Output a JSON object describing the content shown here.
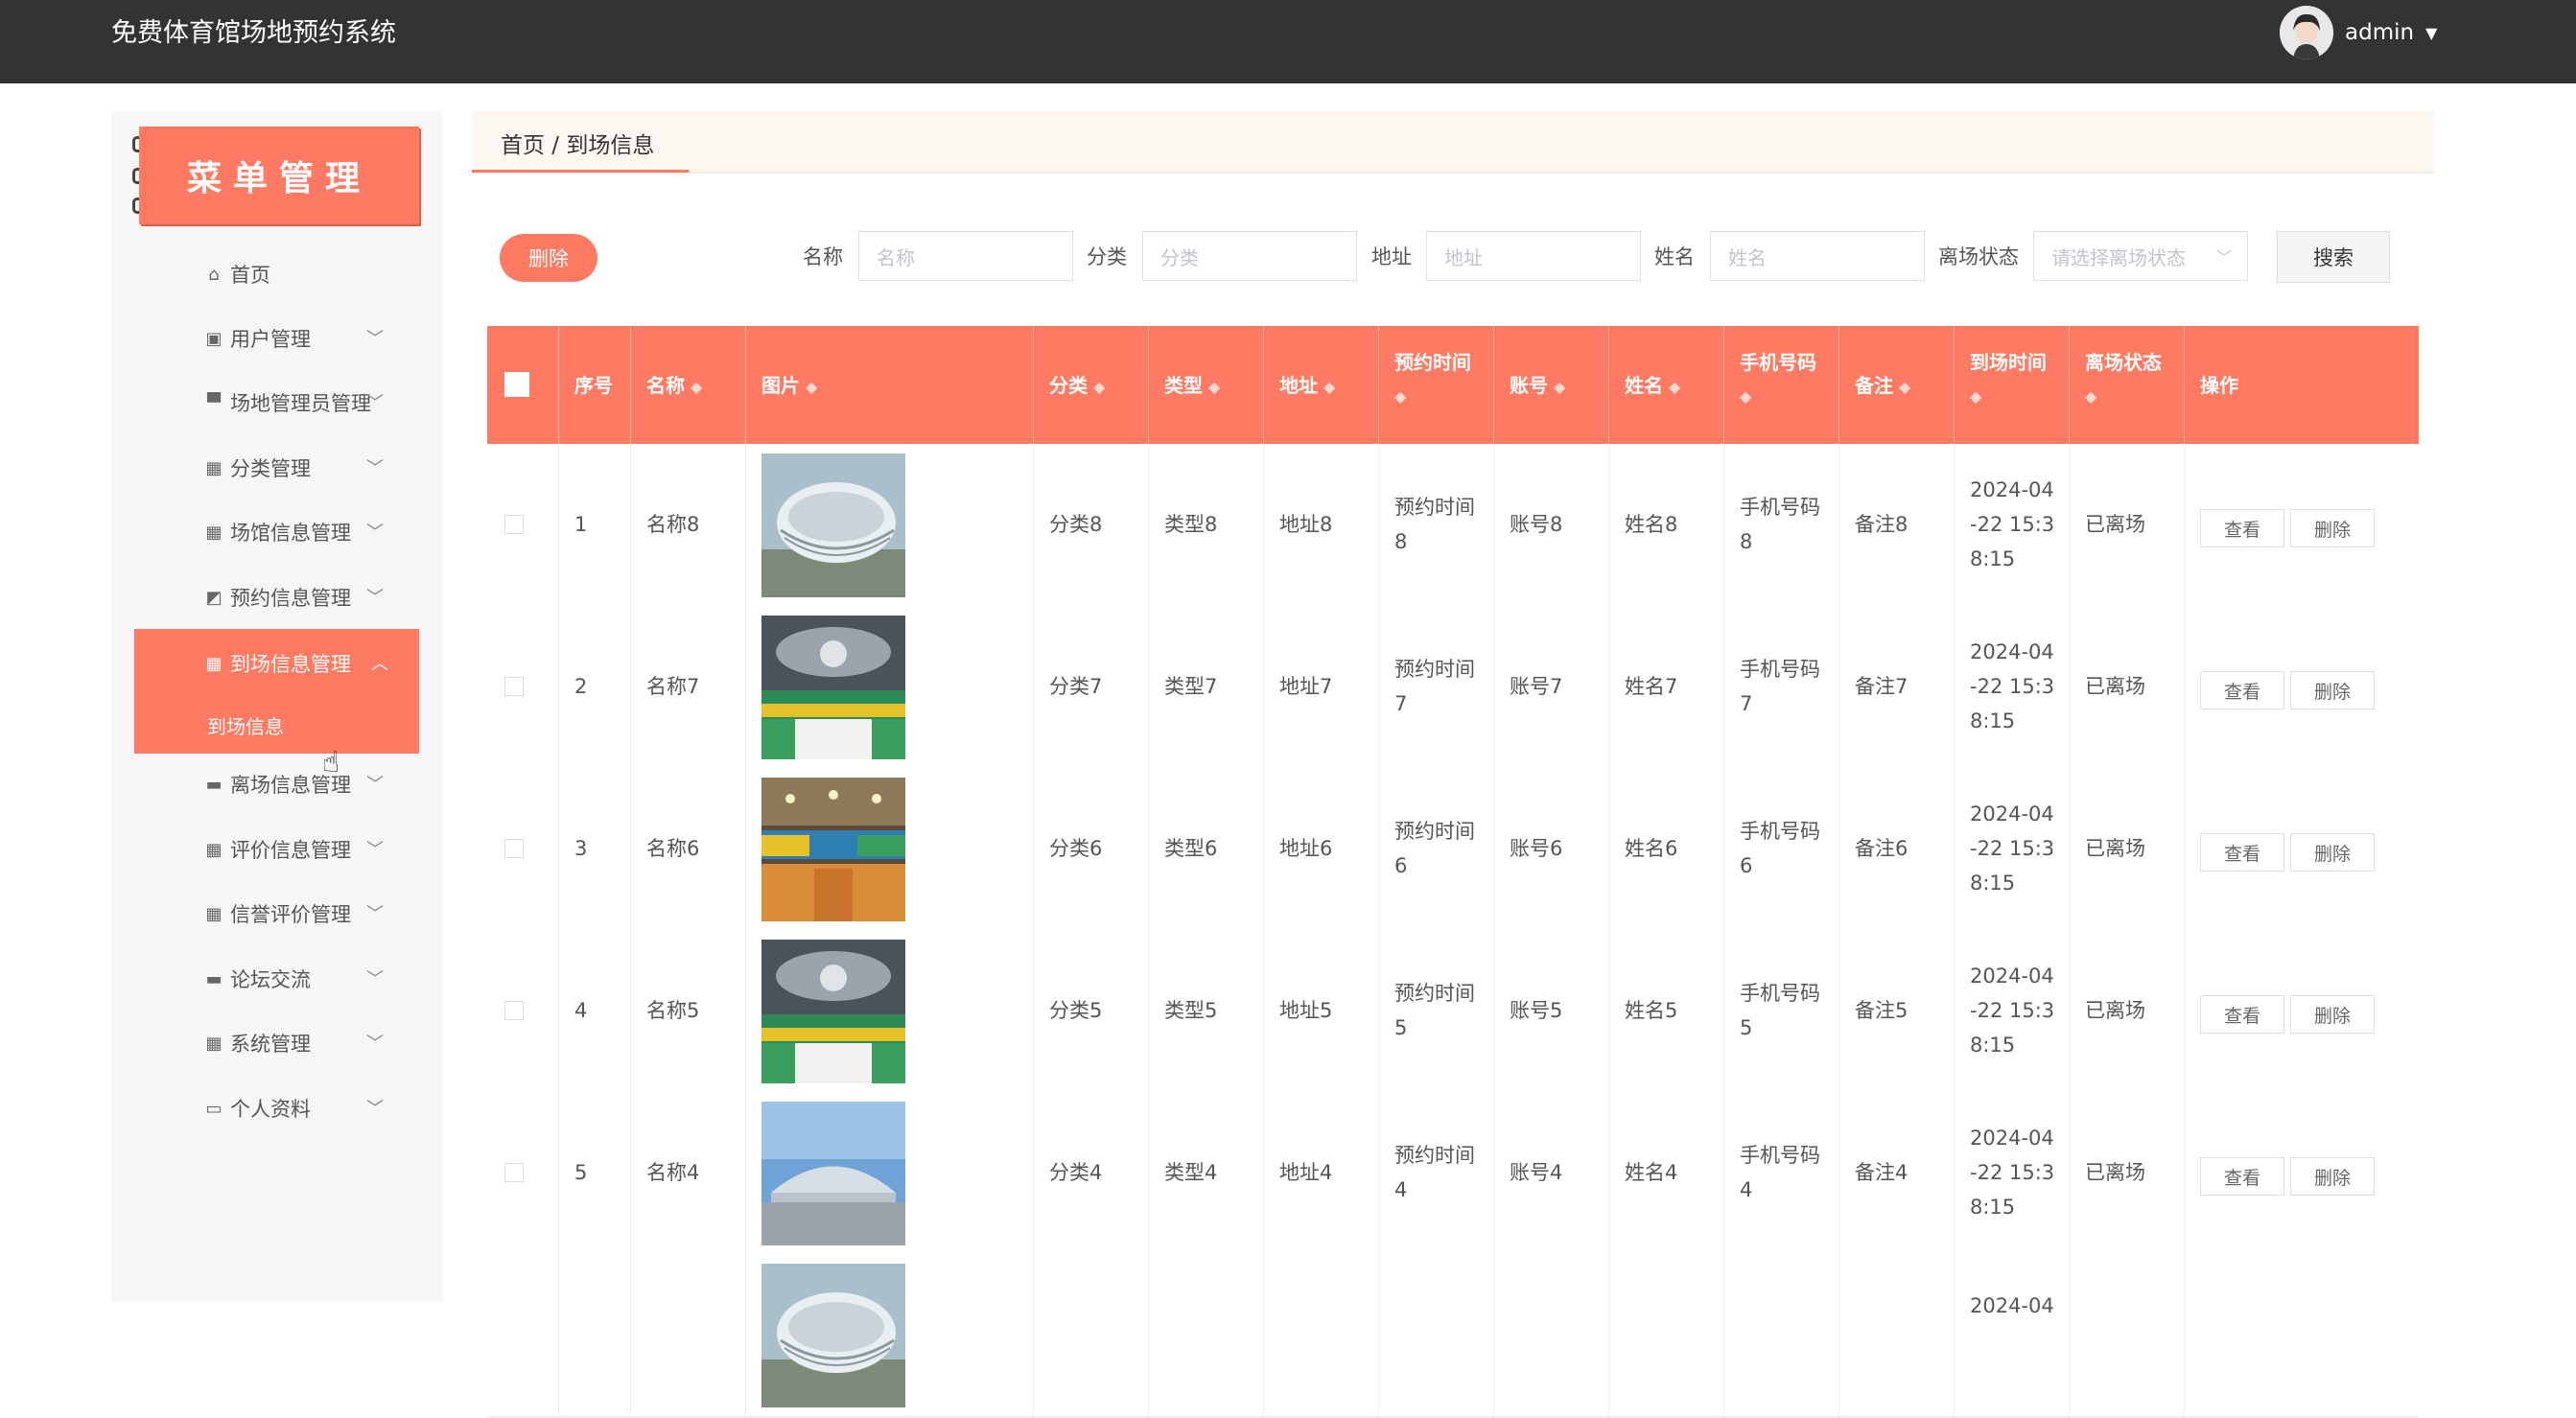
{
  "app": {
    "title": "免费体育馆场地预约系统",
    "user": "admin"
  },
  "sidebar": {
    "banner": "菜单管理",
    "items": [
      {
        "label": "首页",
        "icon": "home-icon",
        "glyph": "⌂"
      },
      {
        "label": "用户管理",
        "icon": "user-icon",
        "glyph": "▣"
      },
      {
        "label": "场地管理员管理",
        "icon": "stamp-icon",
        "glyph": "▀"
      },
      {
        "label": "分类管理",
        "icon": "grid-icon",
        "glyph": "▦"
      },
      {
        "label": "场馆信息管理",
        "icon": "grid-icon",
        "glyph": "▦"
      },
      {
        "label": "预约信息管理",
        "icon": "chart-icon",
        "glyph": "◩"
      },
      {
        "label": "离场信息管理",
        "icon": "briefcase-icon",
        "glyph": "▬"
      },
      {
        "label": "评价信息管理",
        "icon": "grid-icon",
        "glyph": "▦"
      },
      {
        "label": "信誉评价管理",
        "icon": "grid-icon",
        "glyph": "▦"
      },
      {
        "label": "论坛交流",
        "icon": "chat-icon",
        "glyph": "▬"
      },
      {
        "label": "系统管理",
        "icon": "grid-icon",
        "glyph": "▦"
      },
      {
        "label": "个人资料",
        "icon": "card-icon",
        "glyph": "▭"
      }
    ],
    "active": {
      "label": "到场信息管理",
      "icon": "grid-icon",
      "glyph": "▦",
      "sub": "到场信息"
    }
  },
  "breadcrumb": {
    "text": "首页 / 到场信息"
  },
  "toolbar": {
    "delete_label": "删除",
    "search_label": "搜索",
    "filters": [
      {
        "label": "名称",
        "placeholder": "名称"
      },
      {
        "label": "分类",
        "placeholder": "分类"
      },
      {
        "label": "地址",
        "placeholder": "地址"
      },
      {
        "label": "姓名",
        "placeholder": "姓名"
      }
    ],
    "status": {
      "label": "离场状态",
      "placeholder": "请选择离场状态"
    }
  },
  "table": {
    "columns": {
      "index": "序号",
      "name": "名称",
      "image": "图片",
      "category": "分类",
      "type": "类型",
      "address": "地址",
      "booking_time": "预约时间",
      "account": "账号",
      "person": "姓名",
      "phone": "手机号码",
      "note": "备注",
      "arrival_time": "到场时间",
      "leave_status": "离场状态",
      "actions": "操作"
    },
    "view_label": "查看",
    "delete_label": "删除",
    "rows": [
      {
        "index": "1",
        "name": "名称8",
        "category": "分类8",
        "type": "类型8",
        "address": "地址8",
        "booking_time": [
          "预约时间",
          "8"
        ],
        "account": "账号8",
        "person": "姓名8",
        "phone": [
          "手机号码",
          "8"
        ],
        "note": "备注8",
        "arrival_time": [
          "2024-04",
          "-22 15:3",
          "8:15"
        ],
        "leave_status": "已离场",
        "image": "stadium-exterior"
      },
      {
        "index": "2",
        "name": "名称7",
        "category": "分类7",
        "type": "类型7",
        "address": "地址7",
        "booking_time": [
          "预约时间",
          "7"
        ],
        "account": "账号7",
        "person": "姓名7",
        "phone": [
          "手机号码",
          "7"
        ],
        "note": "备注7",
        "arrival_time": [
          "2024-04",
          "-22 15:3",
          "8:15"
        ],
        "leave_status": "已离场",
        "image": "arena-interior"
      },
      {
        "index": "3",
        "name": "名称6",
        "category": "分类6",
        "type": "类型6",
        "address": "地址6",
        "booking_time": [
          "预约时间",
          "6"
        ],
        "account": "账号6",
        "person": "姓名6",
        "phone": [
          "手机号码",
          "6"
        ],
        "note": "备注6",
        "arrival_time": [
          "2024-04",
          "-22 15:3",
          "8:15"
        ],
        "leave_status": "已离场",
        "image": "gym-court"
      },
      {
        "index": "4",
        "name": "名称5",
        "category": "分类5",
        "type": "类型5",
        "address": "地址5",
        "booking_time": [
          "预约时间",
          "5"
        ],
        "account": "账号5",
        "person": "姓名5",
        "phone": [
          "手机号码",
          "5"
        ],
        "note": "备注5",
        "arrival_time": [
          "2024-04",
          "-22 15:3",
          "8:15"
        ],
        "leave_status": "已离场",
        "image": "arena-interior"
      },
      {
        "index": "5",
        "name": "名称4",
        "category": "分类4",
        "type": "类型4",
        "address": "地址4",
        "booking_time": [
          "预约时间",
          "4"
        ],
        "account": "账号4",
        "person": "姓名4",
        "phone": [
          "手机号码",
          "4"
        ],
        "note": "备注4",
        "arrival_time": [
          "2024-04",
          "-22 15:3",
          "8:15"
        ],
        "leave_status": "已离场",
        "image": "stadium-front"
      }
    ],
    "partial_row": {
      "arrival_time": "2024-04",
      "image": "stadium-exterior"
    }
  },
  "colors": {
    "accent": "#ff7a63",
    "topbar": "#333333",
    "sidebar": "#f6f6f6"
  }
}
